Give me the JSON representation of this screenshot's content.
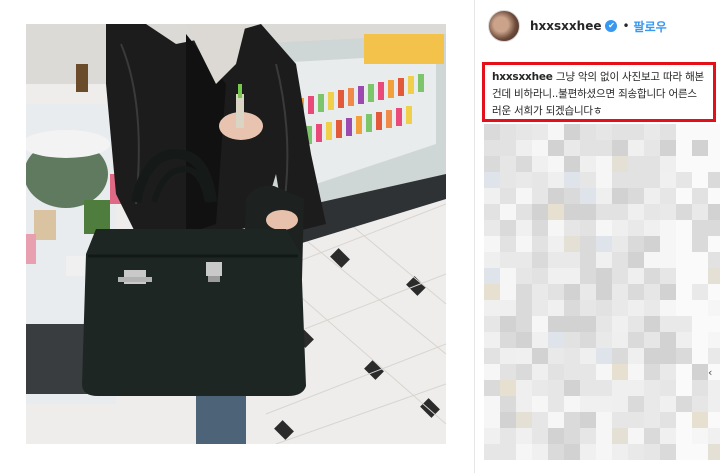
{
  "post": {
    "username": "hxxsxxhee",
    "separator": "•",
    "follow_label": "팔로우",
    "verified_mark": "✔",
    "caption": {
      "author": "hxxsxxhee",
      "text": " 그냥 악의 없이 사진보고 따라 해본건데 비하라니..불편하셨으면 죄송합니다 어른스러운 서희가 되겠습니다ㅎ"
    }
  },
  "colors": {
    "highlight_border": "#e3101a",
    "follow_blue": "#3897f0",
    "text": "#262626"
  },
  "icons": {
    "verified": "verified-badge-icon",
    "avatar": "profile-avatar"
  }
}
